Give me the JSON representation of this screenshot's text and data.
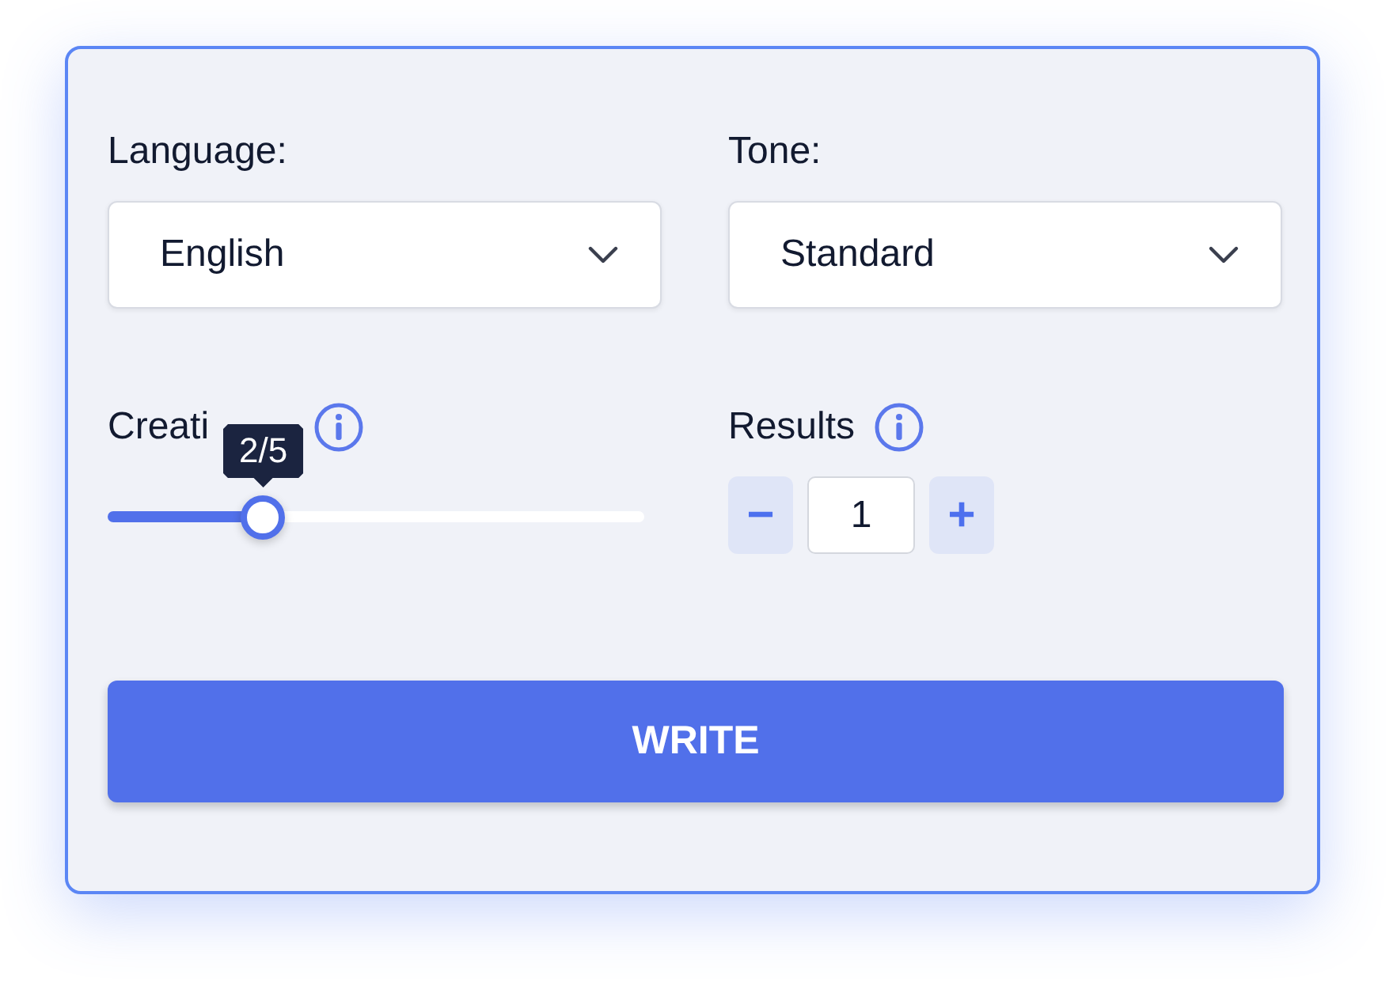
{
  "fields": [
    {
      "label": "Language:",
      "value": "English"
    },
    {
      "label": "Tone:",
      "value": "Standard"
    }
  ],
  "creativity": {
    "label": "Creati",
    "tooltip": "2/5",
    "level": 0.29
  },
  "results": {
    "label": "Results",
    "minus": "−",
    "value": "1",
    "plus": "+"
  },
  "button": "WRITE"
}
